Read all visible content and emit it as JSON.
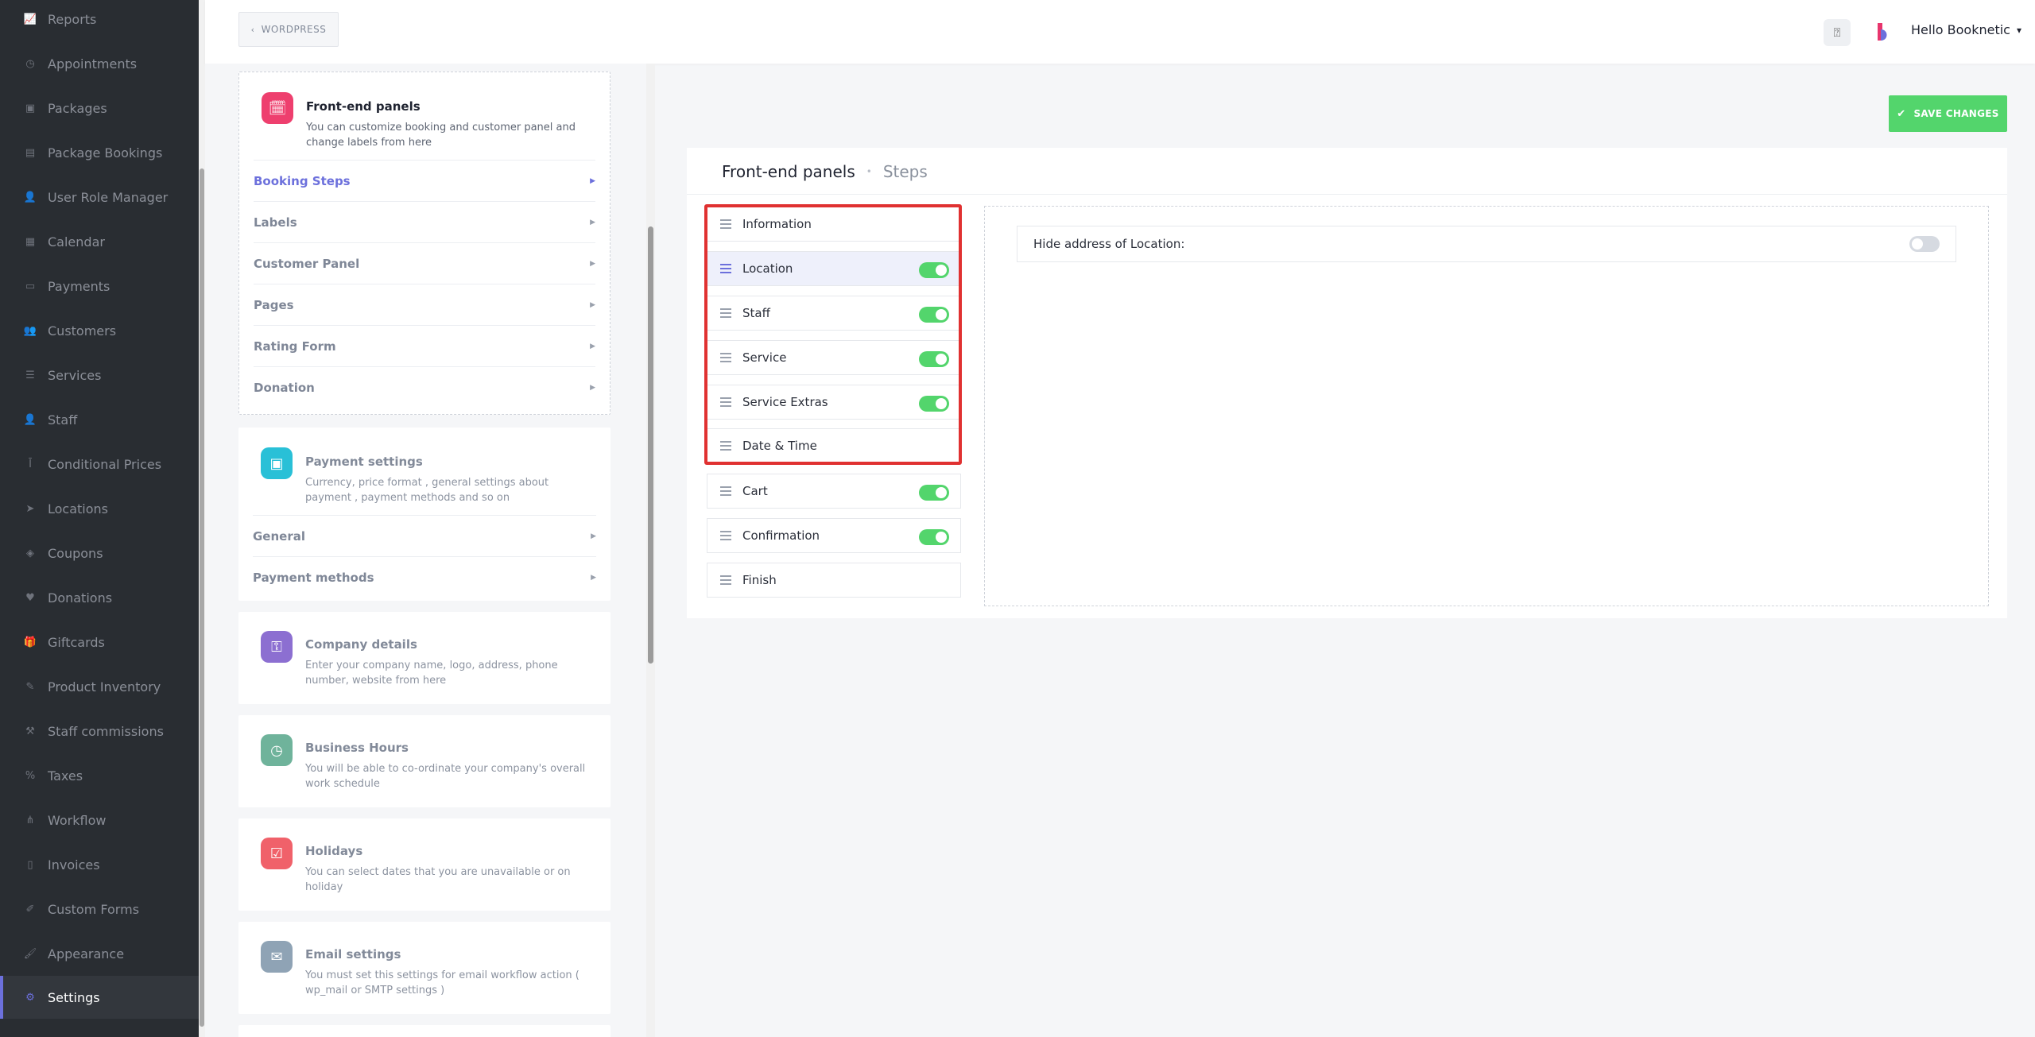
{
  "sidebar": {
    "items": [
      {
        "label": "Reports",
        "icon": "chart-icon"
      },
      {
        "label": "Appointments",
        "icon": "clock-icon"
      },
      {
        "label": "Packages",
        "icon": "box-icon"
      },
      {
        "label": "Package Bookings",
        "icon": "bookings-icon"
      },
      {
        "label": "User Role Manager",
        "icon": "user-role-icon"
      },
      {
        "label": "Calendar",
        "icon": "calendar-icon"
      },
      {
        "label": "Payments",
        "icon": "payment-icon"
      },
      {
        "label": "Customers",
        "icon": "customers-icon"
      },
      {
        "label": "Services",
        "icon": "services-icon"
      },
      {
        "label": "Staff",
        "icon": "staff-icon"
      },
      {
        "label": "Conditional Prices",
        "icon": "conditional-price-icon"
      },
      {
        "label": "Locations",
        "icon": "location-icon"
      },
      {
        "label": "Coupons",
        "icon": "coupon-icon"
      },
      {
        "label": "Donations",
        "icon": "donation-icon"
      },
      {
        "label": "Giftcards",
        "icon": "giftcard-icon"
      },
      {
        "label": "Product Inventory",
        "icon": "inventory-icon"
      },
      {
        "label": "Staff commissions",
        "icon": "commission-icon"
      },
      {
        "label": "Taxes",
        "icon": "percent-icon"
      },
      {
        "label": "Workflow",
        "icon": "workflow-icon"
      },
      {
        "label": "Invoices",
        "icon": "invoice-icon"
      },
      {
        "label": "Custom Forms",
        "icon": "form-icon"
      },
      {
        "label": "Appearance",
        "icon": "brush-icon"
      },
      {
        "label": "Settings",
        "icon": "gear-icon",
        "active": true
      }
    ]
  },
  "topbar": {
    "back_label": "WORDPRESS",
    "user_label": "Hello Booknetic"
  },
  "settings_cards": {
    "frontend": {
      "title": "Front-end panels",
      "desc": "You can customize booking and customer panel and change labels from here",
      "items": [
        "Booking Steps",
        "Labels",
        "Customer Panel",
        "Pages",
        "Rating Form",
        "Donation"
      ]
    },
    "payment": {
      "title": "Payment settings",
      "desc": "Currency, price format , general settings about payment , payment methods and so on",
      "items": [
        "General",
        "Payment methods"
      ]
    },
    "company": {
      "title": "Company details",
      "desc": "Enter your company name, logo, address, phone number, website from here"
    },
    "hours": {
      "title": "Business Hours",
      "desc": "You will be able to co-ordinate your company's overall work schedule"
    },
    "holidays": {
      "title": "Holidays",
      "desc": "You can select dates that you are unavailable or on holiday"
    },
    "email": {
      "title": "Email settings",
      "desc": "You must set this settings for email workflow action ( wp_mail or SMTP settings )"
    }
  },
  "main": {
    "save_label": "SAVE CHANGES",
    "title": "Front-end panels",
    "subtitle": "Steps",
    "steps": [
      {
        "label": "Information",
        "toggle": null
      },
      {
        "label": "Location",
        "toggle": true
      },
      {
        "label": "Staff",
        "toggle": true
      },
      {
        "label": "Service",
        "toggle": true
      },
      {
        "label": "Service Extras",
        "toggle": true
      },
      {
        "label": "Date & Time",
        "toggle": null
      },
      {
        "label": "Cart",
        "toggle": true
      },
      {
        "label": "Confirmation",
        "toggle": true
      },
      {
        "label": "Finish",
        "toggle": null
      }
    ],
    "option_label": "Hide address of Location:",
    "option_enabled": false
  },
  "colors": {
    "accent": "#6c70dc",
    "success": "#53d56c",
    "highlight": "#e03131",
    "sidebar_bg": "#292d32"
  }
}
